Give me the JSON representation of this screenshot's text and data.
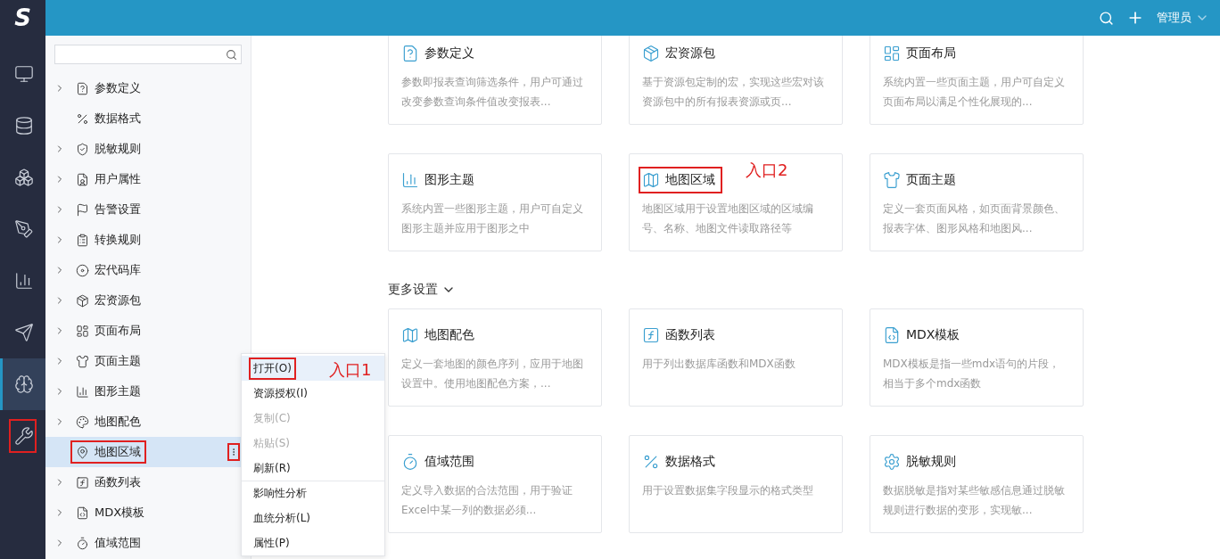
{
  "header": {
    "logo": "S",
    "user": "管理员"
  },
  "rail": [
    {
      "selected": false,
      "annotated": false
    },
    {
      "selected": false,
      "annotated": false
    },
    {
      "selected": false,
      "annotated": false
    },
    {
      "selected": false,
      "annotated": false
    },
    {
      "selected": false,
      "annotated": false
    },
    {
      "selected": false,
      "annotated": false
    },
    {
      "selected": true,
      "annotated": false
    },
    {
      "selected": false,
      "annotated": true
    }
  ],
  "tree": {
    "items": [
      {
        "label": "参数定义",
        "expandable": true,
        "selected": false,
        "annotated": false
      },
      {
        "label": "数据格式",
        "expandable": false,
        "selected": false,
        "annotated": false
      },
      {
        "label": "脱敏规则",
        "expandable": true,
        "selected": false,
        "annotated": false
      },
      {
        "label": "用户属性",
        "expandable": true,
        "selected": false,
        "annotated": false
      },
      {
        "label": "告警设置",
        "expandable": true,
        "selected": false,
        "annotated": false
      },
      {
        "label": "转换规则",
        "expandable": true,
        "selected": false,
        "annotated": false
      },
      {
        "label": "宏代码库",
        "expandable": true,
        "selected": false,
        "annotated": false
      },
      {
        "label": "宏资源包",
        "expandable": true,
        "selected": false,
        "annotated": false
      },
      {
        "label": "页面布局",
        "expandable": true,
        "selected": false,
        "annotated": false
      },
      {
        "label": "页面主题",
        "expandable": true,
        "selected": false,
        "annotated": false
      },
      {
        "label": "图形主题",
        "expandable": true,
        "selected": false,
        "annotated": false
      },
      {
        "label": "地图配色",
        "expandable": true,
        "selected": false,
        "annotated": false
      },
      {
        "label": "地图区域",
        "expandable": false,
        "selected": true,
        "annotated": true
      },
      {
        "label": "函数列表",
        "expandable": true,
        "selected": false,
        "annotated": false
      },
      {
        "label": "MDX模板",
        "expandable": true,
        "selected": false,
        "annotated": false
      },
      {
        "label": "值域范围",
        "expandable": true,
        "selected": false,
        "annotated": false
      }
    ]
  },
  "context_menu": {
    "annotation": "入口1",
    "items": [
      {
        "label": "打开(O)",
        "selected": true,
        "disabled": false,
        "separator_before": false,
        "annotated": true
      },
      {
        "label": "资源授权(I)",
        "selected": false,
        "disabled": false,
        "separator_before": false,
        "annotated": false
      },
      {
        "label": "复制(C)",
        "selected": false,
        "disabled": true,
        "separator_before": false,
        "annotated": false
      },
      {
        "label": "粘贴(S)",
        "selected": false,
        "disabled": true,
        "separator_before": false,
        "annotated": false
      },
      {
        "label": "刷新(R)",
        "selected": false,
        "disabled": false,
        "separator_before": false,
        "annotated": false
      },
      {
        "label": "影响性分析",
        "selected": false,
        "disabled": false,
        "separator_before": true,
        "annotated": false
      },
      {
        "label": "血统分析(L)",
        "selected": false,
        "disabled": false,
        "separator_before": false,
        "annotated": false
      },
      {
        "label": "属性(P)",
        "selected": false,
        "disabled": false,
        "separator_before": false,
        "annotated": false
      }
    ]
  },
  "cards": [
    {
      "title": "参数定义",
      "description": "参数即报表查询筛选条件，用户可通过改变参数查询条件值改变报表...",
      "annotated": false
    },
    {
      "title": "宏资源包",
      "description": "基于资源包定制的宏，实现这些宏对该资源包中的所有报表资源或页...",
      "annotated": false
    },
    {
      "title": "页面布局",
      "description": "系统内置一些页面主题，用户可自定义页面布局以满足个性化展现的...",
      "annotated": false
    },
    {
      "title": "图形主题",
      "description": "系统内置一些图形主题，用户可自定义图形主题并应用于图形之中",
      "annotated": false
    },
    {
      "title": "地图区域",
      "description": "地图区域用于设置地图区域的区域编号、名称、地图文件读取路径等",
      "annotated": true,
      "annotation": "入口2"
    },
    {
      "title": "页面主题",
      "description": "定义一套页面风格，如页面背景颜色、报表字体、图形风格和地图风...",
      "annotated": false
    }
  ],
  "more_settings": {
    "title": "更多设置",
    "expanded": true,
    "cards": [
      {
        "title": "地图配色",
        "description": "定义一套地图的颜色序列，应用于地图设置中。使用地图配色方案，...",
        "annotated": false
      },
      {
        "title": "函数列表",
        "description": "用于列出数据库函数和MDX函数",
        "annotated": false
      },
      {
        "title": "MDX模板",
        "description": "MDX模板是指一些mdx语句的片段，相当于多个mdx函数",
        "annotated": false
      },
      {
        "title": "值域范围",
        "description": "定义导入数据的合法范围，用于验证Excel中某一列的数据必须...",
        "annotated": false
      },
      {
        "title": "数据格式",
        "description": "用于设置数据集字段显示的格式类型",
        "annotated": false
      },
      {
        "title": "脱敏规则",
        "description": "数据脱敏是指对某些敏感信息通过脱敏规则进行数据的变形，实现敏...",
        "annotated": false
      }
    ]
  }
}
